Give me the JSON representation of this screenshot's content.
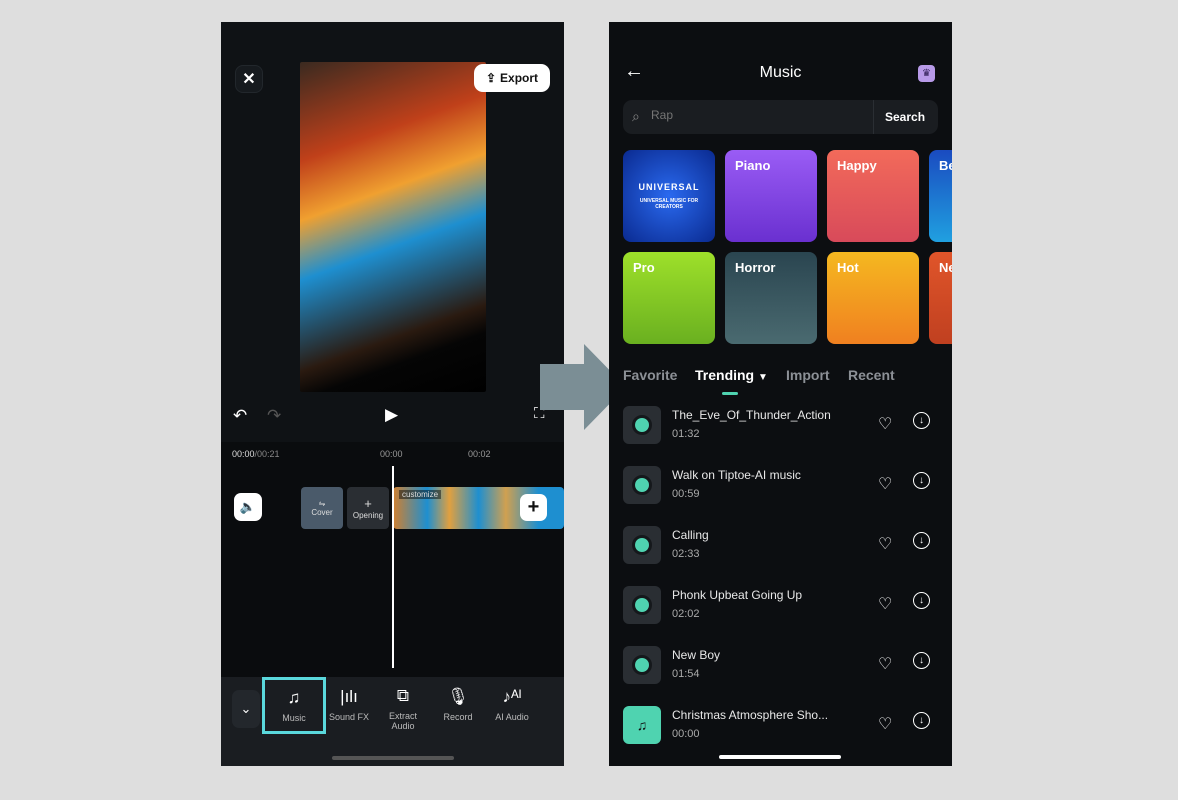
{
  "editor": {
    "close_icon": "close-icon",
    "export_label": "Export",
    "current_time": "00:00",
    "total_time": "/00:21",
    "ticks": [
      "00:00",
      "00:02"
    ],
    "cover_label": "Cover",
    "opening_label": "Opening",
    "customize_label": "customize",
    "tools": [
      {
        "label": "Music",
        "icon": "music-note-icon",
        "selected": true
      },
      {
        "label": "Sound FX",
        "icon": "sound-wave-icon"
      },
      {
        "label": "Extract\nAudio",
        "icon": "extract-audio-icon"
      },
      {
        "label": "Record",
        "icon": "microphone-icon"
      },
      {
        "label": "AI Audio",
        "icon": "ai-audio-icon"
      }
    ],
    "highlight_color": "#5ad8dc"
  },
  "music": {
    "title": "Music",
    "search_placeholder": "Rap",
    "search_button": "Search",
    "categories": [
      {
        "label": "",
        "logo_text": "UNIVERSAL",
        "logo_sub": "UNIVERSAL MUSIC FOR CREATORS",
        "color": "#1a4bd0"
      },
      {
        "label": "Piano",
        "color": "#8a4cf0"
      },
      {
        "label": "Happy",
        "color": "#f0605a"
      },
      {
        "label": "Be",
        "color": "#1a6ad0"
      },
      {
        "label": "Pro",
        "color": "#8ed22a"
      },
      {
        "label": "Horror",
        "color": "#3a5560"
      },
      {
        "label": "Hot",
        "color": "#f5a81a"
      },
      {
        "label": "Ne",
        "color": "#e0552a"
      }
    ],
    "tabs": [
      "Favorite",
      "Trending",
      "Import",
      "Recent"
    ],
    "active_tab": "Trending",
    "accent": "#4fd3b0",
    "tracks": [
      {
        "name": "The_Eve_Of_Thunder_Action",
        "duration": "01:32"
      },
      {
        "name": "Walk on Tiptoe-AI music",
        "duration": "00:59"
      },
      {
        "name": "Calling",
        "duration": "02:33"
      },
      {
        "name": "Phonk Upbeat Going Up",
        "duration": "02:02"
      },
      {
        "name": "New Boy",
        "duration": "01:54"
      },
      {
        "name": "Christmas Atmosphere Sho...",
        "duration": "00:00"
      }
    ]
  }
}
